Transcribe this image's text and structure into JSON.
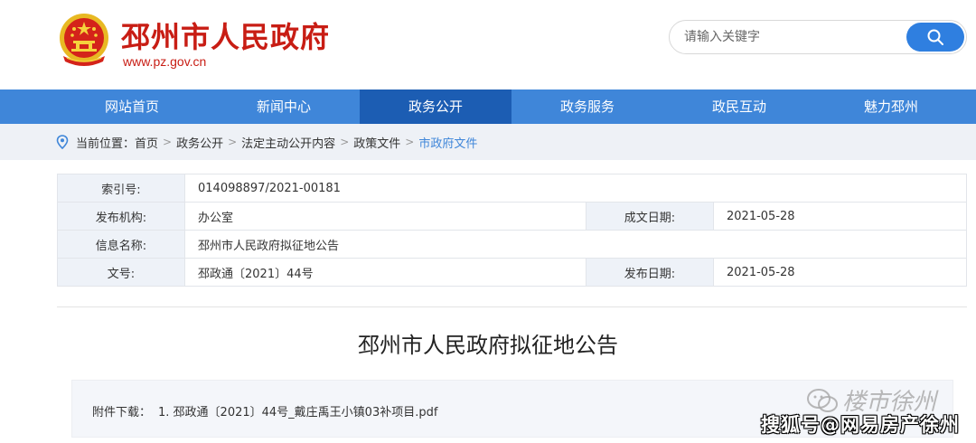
{
  "header": {
    "site_title": "邳州市人民政府",
    "site_url": "www.pz.gov.cn",
    "search_placeholder": "请输入关键字"
  },
  "nav": {
    "items": [
      "网站首页",
      "新闻中心",
      "政务公开",
      "政务服务",
      "政民互动",
      "魅力邳州"
    ],
    "active_index": 2
  },
  "breadcrumb": {
    "prefix": "当前位置：",
    "items": [
      "首页",
      "政务公开",
      "法定主动公开内容",
      "政策文件",
      "市政府文件"
    ],
    "separator": ">"
  },
  "info": {
    "index_label": "索引号:",
    "index_value": "014098897/2021-00181",
    "publisher_label": "发布机构:",
    "publisher_value": "办公室",
    "created_label": "成文日期:",
    "created_value": "2021-05-28",
    "name_label": "信息名称:",
    "name_value": "邳州市人民政府拟征地公告",
    "docno_label": "文号:",
    "docno_value": "邳政通〔2021〕44号",
    "published_label": "发布日期:",
    "published_value": "2021-05-28"
  },
  "document": {
    "title": "邳州市人民政府拟征地公告",
    "attachment_label": "附件下载：",
    "attachment_file": "1. 邳政通〔2021〕44号_戴庄禹王小镇03补项目.pdf"
  },
  "watermark": {
    "line1": "楼市徐州",
    "line2": "搜狐号@网易房产徐州"
  },
  "colors": {
    "brand_red": "#c81d14",
    "nav_blue": "#3f86d9",
    "nav_active": "#1c5db3",
    "search_button": "#2f7fe0"
  }
}
